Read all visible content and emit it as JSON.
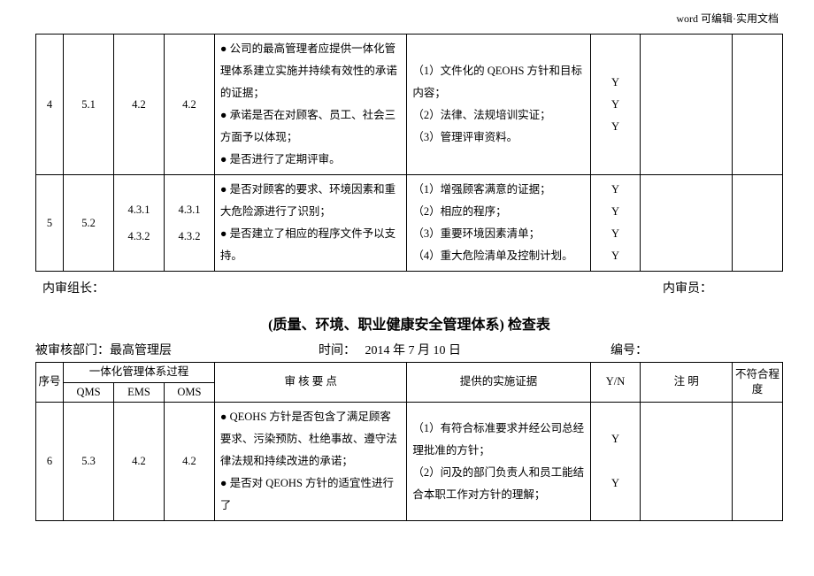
{
  "header_note": "word 可编辑·实用文档",
  "table1": {
    "rows": [
      {
        "seq": "4",
        "qms": "5.1",
        "ems": "4.2",
        "oms": "4.2",
        "keypoints": "● 公司的最高管理者应提供一体化管理体系建立实施并持续有效性的承诺的证据；\n● 承诺是否在对顾客、员工、社会三方面予以体现；\n● 是否进行了定期评审。",
        "evidence": "（1）文件化的 QEOHS 方针和目标内容；\n（2）法律、法规培训实证；\n（3）管理评审资料。",
        "yn": "Y\nY\nY",
        "note": "",
        "degree": ""
      },
      {
        "seq": "5",
        "qms": "5.2",
        "ems": "4.3.1\n4.3.2",
        "oms": "4.3.1\n4.3.2",
        "keypoints": "● 是否对顾客的要求、环境因素和重大危险源进行了识别；\n● 是否建立了相应的程序文件予以支持。",
        "evidence": "（1）增强顾客满意的证据；\n（2）相应的程序；\n（3）重要环境因素清单；\n（4）重大危险清单及控制计划。",
        "yn": "Y\nY\nY\nY",
        "note": "",
        "degree": ""
      }
    ]
  },
  "sign": {
    "leader_label": "内审组长：",
    "member_label": "内审员："
  },
  "title": "(质量、环境、职业健康安全管理体系) 检查表",
  "info": {
    "dept_label": "被审核部门：",
    "dept_value": "最高管理层",
    "time_label": "时间：",
    "time_value": "2014 年 7 月 10 日",
    "no_label": "编号："
  },
  "table2": {
    "header": {
      "seq": "序号",
      "proc": "一体化管理体系过程",
      "qms": "QMS",
      "ems": "EMS",
      "oms": "OMS",
      "keypoints": "审 核 要 点",
      "evidence": "提供的实施证据",
      "yn": "Y/N",
      "note": "注  明",
      "degree": "不符合程 度"
    },
    "rows": [
      {
        "seq": "6",
        "qms": "5.3",
        "ems": "4.2",
        "oms": "4.2",
        "keypoints": "● QEOHS 方针是否包含了满足顾客要求、污染预防、杜绝事故、遵守法律法规和持续改进的承诺；\n● 是否对 QEOHS 方针的适宜性进行了",
        "evidence": "（1）有符合标准要求并经公司总经理批准的方针；\n（2）问及的部门负责人和员工能结合本职工作对方针的理解；",
        "yn": "Y\n\nY",
        "note": "",
        "degree": ""
      }
    ]
  }
}
